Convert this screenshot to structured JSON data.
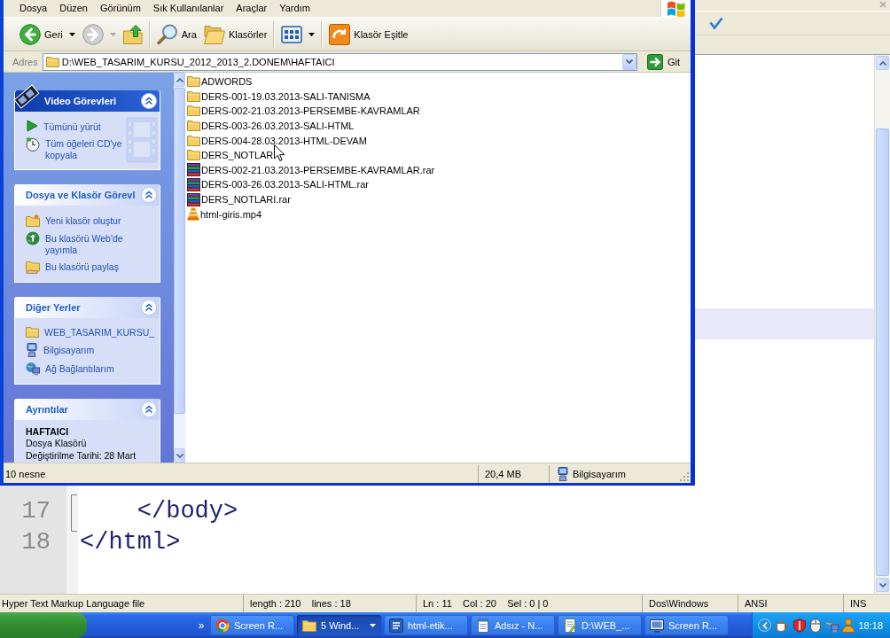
{
  "explorer": {
    "menu": [
      "Dosya",
      "Düzen",
      "Görünüm",
      "Sık Kullanılanlar",
      "Araçlar",
      "Yardım"
    ],
    "toolbar": [
      [
        {
          "kind": "back",
          "label": "Geri",
          "dropdown": true,
          "disabled": false
        },
        {
          "kind": "forward",
          "dropdown": true,
          "disabled": true
        },
        {
          "kind": "up",
          "dropdown": false,
          "disabled": false
        }
      ],
      [
        {
          "kind": "search",
          "label": "Ara",
          "dropdown": false,
          "disabled": false
        },
        {
          "kind": "folders",
          "label": "Klasörler",
          "dropdown": false,
          "disabled": false
        }
      ],
      [
        {
          "kind": "views",
          "dropdown": true,
          "disabled": false
        }
      ],
      [
        {
          "kind": "sync",
          "label": "Klasör Eşitle",
          "dropdown": false,
          "disabled": false
        }
      ]
    ],
    "address": {
      "label": "Adres",
      "value": "D:\\WEB_TASARIM_KURSU_2012_2013_2.DONEM\\HAFTAICI",
      "go": "Git"
    },
    "task_panes": [
      {
        "kind": "special",
        "title": "Video Görevleri",
        "expanded": true,
        "items": [
          {
            "kind": "play",
            "label": "Tümünü yürüt"
          },
          {
            "kind": "burn",
            "label": "Tüm öğeleri CD'ye kopyala"
          }
        ]
      },
      {
        "kind": "normal",
        "title": "Dosya ve Klasör Görevl",
        "expanded": true,
        "items": [
          {
            "kind": "new_folder",
            "label": "Yeni klasör oluştur"
          },
          {
            "kind": "publish",
            "label": "Bu klasörü Web'de yayımla"
          },
          {
            "kind": "share",
            "label": "Bu klasörü paylaş"
          }
        ]
      },
      {
        "kind": "normal",
        "title": "Diğer Yerler",
        "expanded": true,
        "items": [
          {
            "kind": "folder",
            "label": "WEB_TASARIM_KURSU_"
          },
          {
            "kind": "computer",
            "label": "Bilgisayarım"
          },
          {
            "kind": "network",
            "label": "Ağ Bağlantılarım"
          }
        ]
      },
      {
        "kind": "normal",
        "title": "Ayrıntılar",
        "expanded": true,
        "details": {
          "name": "HAFTAICI",
          "type": "Dosya Klasörü",
          "modified": "Değiştirilme Tarihi: 28 Mart"
        }
      }
    ],
    "files": [
      {
        "kind": "folder",
        "name": "ADWORDS"
      },
      {
        "kind": "folder",
        "name": "DERS-001-19.03.2013-SALI-TANISMA"
      },
      {
        "kind": "folder",
        "name": "DERS-002-21.03.2013-PERSEMBE-KAVRAMLAR"
      },
      {
        "kind": "folder",
        "name": "DERS-003-26.03.2013-SALI-HTML"
      },
      {
        "kind": "folder",
        "name": "DERS-004-28.03.2013-HTML-DEVAM"
      },
      {
        "kind": "folder",
        "name": "DERS_NOTLAR"
      },
      {
        "kind": "archive",
        "name": "DERS-002-21.03.2013-PERSEMBE-KAVRAMLAR.rar"
      },
      {
        "kind": "archive",
        "name": "DERS-003-26.03.2013-SALI-HTML.rar"
      },
      {
        "kind": "archive",
        "name": "DERS_NOTLARI.rar"
      },
      {
        "kind": "video",
        "name": "html-giris.mp4"
      }
    ],
    "status_bar": {
      "objects": "10 nesne",
      "size": "20,4 MB",
      "zone": "Bilgisayarım"
    }
  },
  "editor": {
    "lines": [
      {
        "number": "17",
        "code": "    </body>"
      },
      {
        "number": "18",
        "code": "</html>"
      }
    ],
    "status_bar": [
      "Hyper Text Markup Language file",
      "length : 210    lines : 18",
      "Ln : 11    Col : 20    Sel : 0 | 0",
      "Dos\\Windows",
      "ANSI",
      "INS"
    ]
  },
  "taskbar": {
    "quick_launch": "»",
    "tasks": [
      {
        "kind": "browser",
        "label": "Screen R...",
        "selected": false,
        "dropdown": false
      },
      {
        "kind": "folder",
        "label": "5 Wind...",
        "selected": true,
        "dropdown": true
      },
      {
        "kind": "word",
        "label": "html-etik...",
        "selected": false,
        "dropdown": false
      },
      {
        "kind": "notepad",
        "label": "Adsız - N...",
        "selected": false,
        "dropdown": false
      },
      {
        "kind": "editor",
        "label": "D:\\WEB_...",
        "selected": false,
        "dropdown": false
      },
      {
        "kind": "recorder",
        "label": "Screen R...",
        "selected": false,
        "dropdown": false
      }
    ],
    "clock": "18:18"
  }
}
